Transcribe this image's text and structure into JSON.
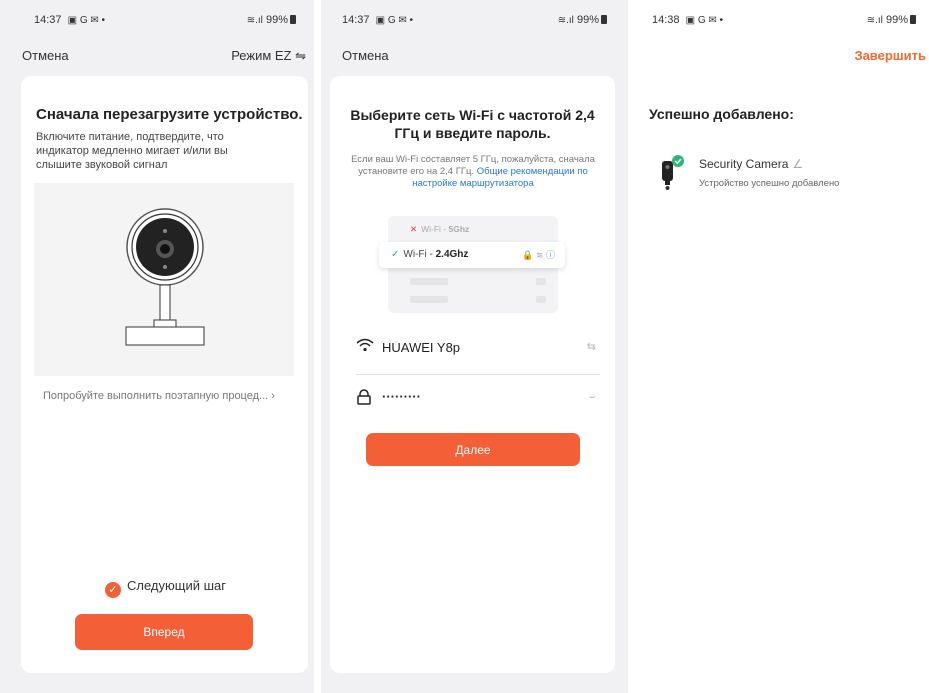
{
  "screen1": {
    "status": {
      "time": "14:37",
      "icons": "▣ G ✉ •",
      "system": "99%"
    },
    "nav": {
      "cancel": "Отмена",
      "mode": "Режим EZ ⇋"
    },
    "title": "Сначала перезагрузите устройство.",
    "description": "Включите питание, подтвердите, что индикатор медленно мигает и/или вы слышите звуковой сигнал",
    "link": "Попробуйте выполнить поэтапную процед... ›",
    "checkbox_label": "Следующий шаг",
    "button": "Вперед"
  },
  "screen2": {
    "status": {
      "time": "14:37",
      "icons": "▣ G ✉ •",
      "system": "99%"
    },
    "nav": {
      "cancel": "Отмена"
    },
    "title": "Выберите сеть Wi-Fi с частотой 2,4 ГГц и введите пароль.",
    "description": "Если ваш Wi-Fi составляет 5 ГГц, пожалуйста, сначала установите его на 2,4 ГГц.",
    "description_link": "Общие рекомендации по настройке маршрутизатора",
    "illustration": {
      "row_5g_prefix": "Wi-Fi - ",
      "row_5g": "5Ghz",
      "row_24_prefix": "Wi-Fi - ",
      "row_24": "2.4Ghz"
    },
    "wifi_name": "HUAWEI Y8p",
    "password": "·········",
    "button": "Далее"
  },
  "screen3": {
    "status": {
      "time": "14:38",
      "icons": "▣ G ✉ •",
      "system": "99%"
    },
    "nav": {
      "finish": "Завершить"
    },
    "title": "Успешно добавлено:",
    "device_name": "Security Camera",
    "device_status": "Устройство успешно добавлено"
  },
  "colors": {
    "accent": "#f35f36",
    "success": "#2bb673",
    "link": "#2a78c8"
  }
}
